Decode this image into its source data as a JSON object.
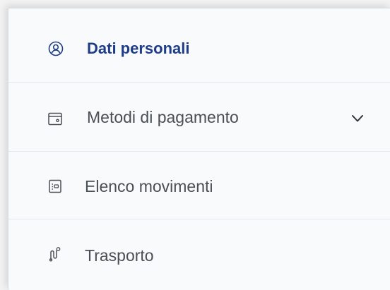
{
  "menu": {
    "items": [
      {
        "label": "Dati personali",
        "icon": "user-circle-icon",
        "active": true
      },
      {
        "label": "Metodi di pagamento",
        "icon": "wallet-icon",
        "expandable": true,
        "chevron_icon": "chevron-down-icon"
      },
      {
        "label": "Elenco movimenti",
        "icon": "list-icon"
      },
      {
        "label": "Trasporto",
        "icon": "route-icon"
      }
    ]
  },
  "colors": {
    "active": "#1f3c88",
    "text": "#4a4f55",
    "background": "#f9fafb",
    "divider": "#e4e7eb"
  }
}
